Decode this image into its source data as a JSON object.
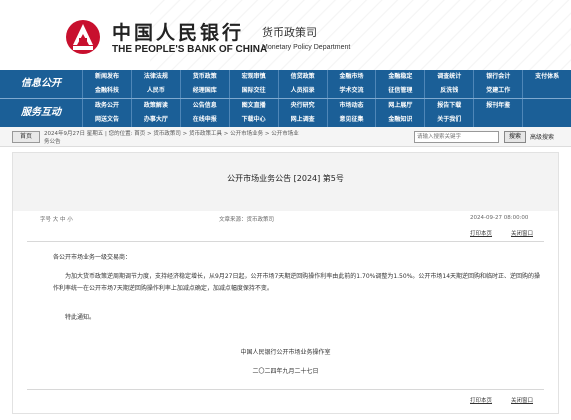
{
  "header": {
    "bank_name_cn": "中国人民银行",
    "bank_name_en": "THE PEOPLE'S BANK OF CHINA",
    "dept_name_cn": "货币政策司",
    "dept_name_en": "Monetary Policy Department"
  },
  "nav": {
    "section_titles": [
      "信息公开",
      "服务互动"
    ],
    "rows": [
      [
        "新闻发布",
        "法律法规",
        "货币政策",
        "宏观审慎",
        "信贷政策",
        "金融市场",
        "金融稳定",
        "调查统计",
        "银行会计",
        "支付体系"
      ],
      [
        "金融科技",
        "人民币",
        "经理国库",
        "国际交往",
        "人员招录",
        "学术交流",
        "征信管理",
        "反洗钱",
        "党建工作",
        ""
      ],
      [
        "政务公开",
        "政策解读",
        "公告信息",
        "图文直播",
        "央行研究",
        "市场动态",
        "网上展厅",
        "报告下载",
        "报刊年鉴",
        ""
      ],
      [
        "网送文告",
        "办事大厅",
        "在线申报",
        "下载中心",
        "网上调查",
        "意见征集",
        "金融知识",
        "关于我们",
        "",
        ""
      ]
    ]
  },
  "crumbbar": {
    "home_label": "首页",
    "date_text": "2024年9月27日 星期五",
    "location_prefix": "| 您的位置:",
    "path_items": [
      "首页",
      "货币政策司",
      "货币政策工具",
      "公开市场业务",
      "公开市场业"
    ],
    "path_tail": "务公告",
    "search_placeholder": "请输入搜索关键字",
    "search_button": "搜索",
    "advanced_search": "高级搜索"
  },
  "article": {
    "title": "公开市场业务公告  [2024] 第5号",
    "meta_left": "字号 大 中 小",
    "source": "文章来源：货币政策司",
    "timestamp": "2024-09-27 08:00:00",
    "print_label": "打印本页",
    "close_label": "关闭窗口",
    "salutation": "各公开市场业务一级交易商：",
    "body": "为加大货币政策逆周期调节力度，支持经济稳定增长，从9月27日起，公开市场7天期逆回购操作利率由此前的1.70%调整为1.50%。公开市场14天期逆回购和临时正、逆回购的操作利率统一在公开市场7天期逆回购操作利率上加减点确定，加减点幅度保持不变。",
    "closing": "特此通知。",
    "signature_org": "中国人民银行公开市场业务操作室",
    "signature_date": "二〇二四年九月二十七日"
  },
  "colors": {
    "nav_background": "#1b5f97",
    "logo_red": "#c8102e"
  }
}
